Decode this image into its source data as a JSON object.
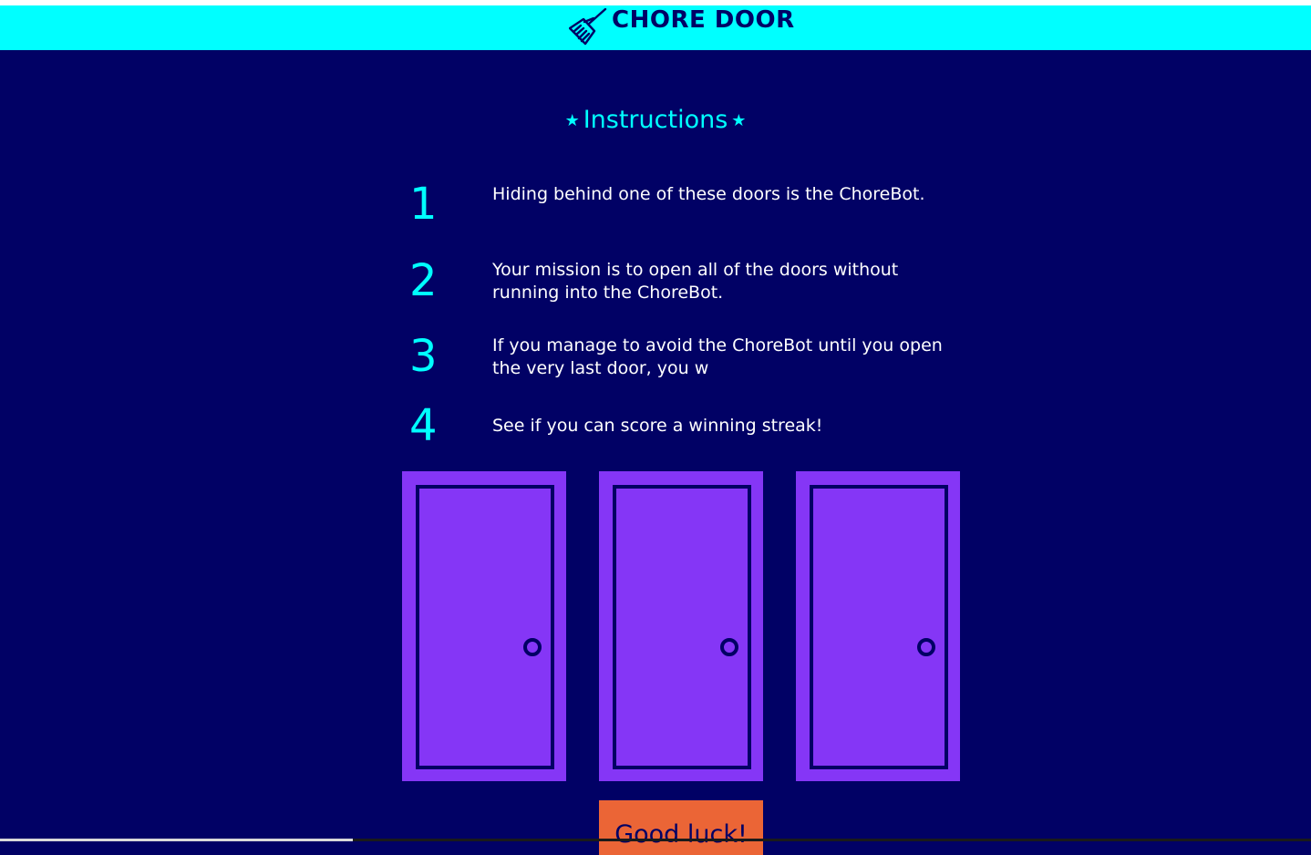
{
  "header": {
    "title": "CHORE DOOR",
    "logo_icon": "broom-icon",
    "background_color": "#00ffff"
  },
  "instructions": {
    "heading": "Instructions",
    "star_glyph": "★",
    "steps": [
      {
        "number": "1",
        "text": "Hiding behind one of these doors is the ChoreBot."
      },
      {
        "number": "2",
        "text": "Your mission is to open all of the doors without running into the ChoreBot."
      },
      {
        "number": "3",
        "text": "If you manage to avoid the ChoreBot until you open the very last door, you w"
      },
      {
        "number": "4",
        "text": "See if you can score a winning streak!"
      }
    ]
  },
  "doors": [
    {
      "icon": "closed-door-icon"
    },
    {
      "icon": "closed-door-icon"
    },
    {
      "icon": "closed-door-icon"
    }
  ],
  "start_button": {
    "label": "Good luck!"
  },
  "colors": {
    "page_background": "#010165",
    "accent_cyan": "#00ffff",
    "door_purple": "#8536f6",
    "button_orange": "#eb6536",
    "text_white": "#ffffff"
  }
}
